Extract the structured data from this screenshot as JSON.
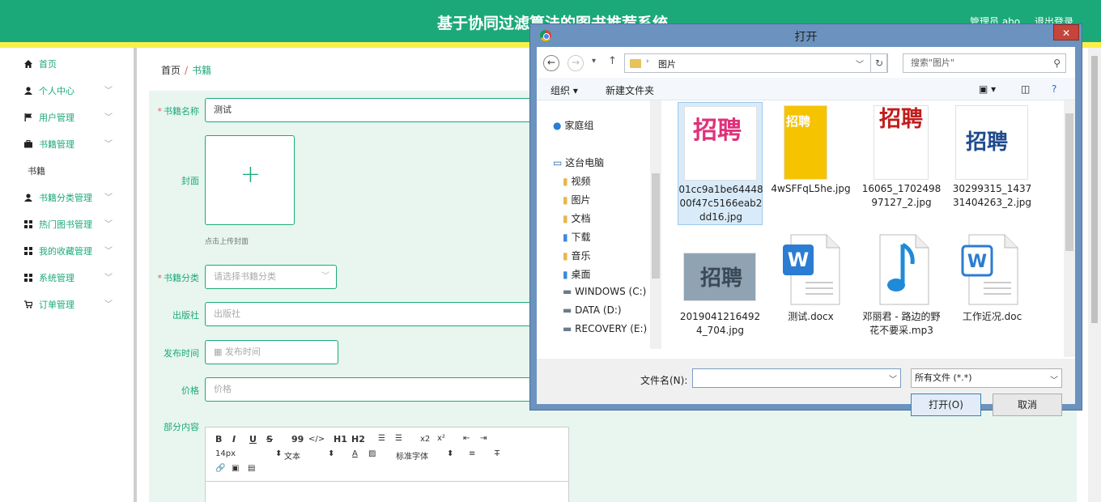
{
  "header": {
    "title": "基于协同过滤算法的图书推荐系统",
    "user": "管理员 abo",
    "logout": "退出登录",
    "bg_color": "#1ca97a",
    "stripe_color": "#f8f04a"
  },
  "sidebar": {
    "items": [
      {
        "label": "首页",
        "icon": "home-icon"
      },
      {
        "label": "个人中心",
        "icon": "user-icon"
      },
      {
        "label": "用户管理",
        "icon": "flag-icon"
      },
      {
        "label": "书籍管理",
        "icon": "briefcase-icon"
      },
      {
        "label": "书籍",
        "icon": ""
      },
      {
        "label": "书籍分类管理",
        "icon": "user-icon"
      },
      {
        "label": "热门图书管理",
        "icon": "grid-icon"
      },
      {
        "label": "我的收藏管理",
        "icon": "grid-icon"
      },
      {
        "label": "系统管理",
        "icon": "grid-icon"
      },
      {
        "label": "订单管理",
        "icon": "cart-icon"
      }
    ]
  },
  "breadcrumb": {
    "home": "首页",
    "sep": "/",
    "current": "书籍"
  },
  "form": {
    "name_label": "书籍名称",
    "name_value": "测试",
    "cover_label": "封面",
    "upload_hint": "点击上传封面",
    "category_label": "书籍分类",
    "category_placeholder": "请选择书籍分类",
    "publisher_label": "出版社",
    "publisher_placeholder": "出版社",
    "date_label": "发布时间",
    "date_placeholder": "发布时间",
    "price_label": "价格",
    "price_placeholder": "价格",
    "content_label": "部分内容",
    "required_mark": "*"
  },
  "editor": {
    "font_size": "14px",
    "text_style": "文本",
    "font_family": "标准字体",
    "tools": [
      "B",
      "I",
      "U",
      "S",
      "99",
      "</>",
      "H1",
      "H2",
      "x2",
      "x²"
    ]
  },
  "dialog": {
    "title": "打开",
    "close": "✕",
    "address": "图片",
    "search_placeholder": "搜索\"图片\"",
    "organize": "组织",
    "new_folder": "新建文件夹",
    "tree": [
      {
        "label": "家庭组",
        "icon": "homegroup-icon"
      },
      {
        "label": "这台电脑",
        "icon": "computer-icon"
      },
      {
        "label": "视频",
        "icon": "folder-icon"
      },
      {
        "label": "图片",
        "icon": "folder-icon"
      },
      {
        "label": "文档",
        "icon": "folder-icon"
      },
      {
        "label": "下载",
        "icon": "folder-icon"
      },
      {
        "label": "音乐",
        "icon": "folder-icon"
      },
      {
        "label": "桌面",
        "icon": "folder-icon"
      },
      {
        "label": "WINDOWS (C:)",
        "icon": "drive-icon"
      },
      {
        "label": "DATA (D:)",
        "icon": "drive-icon"
      },
      {
        "label": "RECOVERY (E:)",
        "icon": "drive-icon"
      }
    ],
    "files": [
      {
        "name": "01cc9a1be6444800f47c5166eab2dd16.jpg",
        "selected": true
      },
      {
        "name": "4wSFFqL5he.jpg",
        "selected": false
      },
      {
        "name": "16065_170249897127_2.jpg",
        "selected": false
      },
      {
        "name": "30299315_143731404263_2.jpg",
        "selected": false
      },
      {
        "name": "20190412164924_704.jpg",
        "selected": false
      },
      {
        "name": "测试.docx",
        "selected": false
      },
      {
        "name": "邓丽君 - 路边的野花不要采.mp3",
        "selected": false
      },
      {
        "name": "工作近况.doc",
        "selected": false
      }
    ],
    "filename_label": "文件名(N):",
    "filename_value": "",
    "filter": "所有文件 (*.*)",
    "open": "打开(O)",
    "cancel": "取消",
    "thumb_text": "招聘"
  }
}
